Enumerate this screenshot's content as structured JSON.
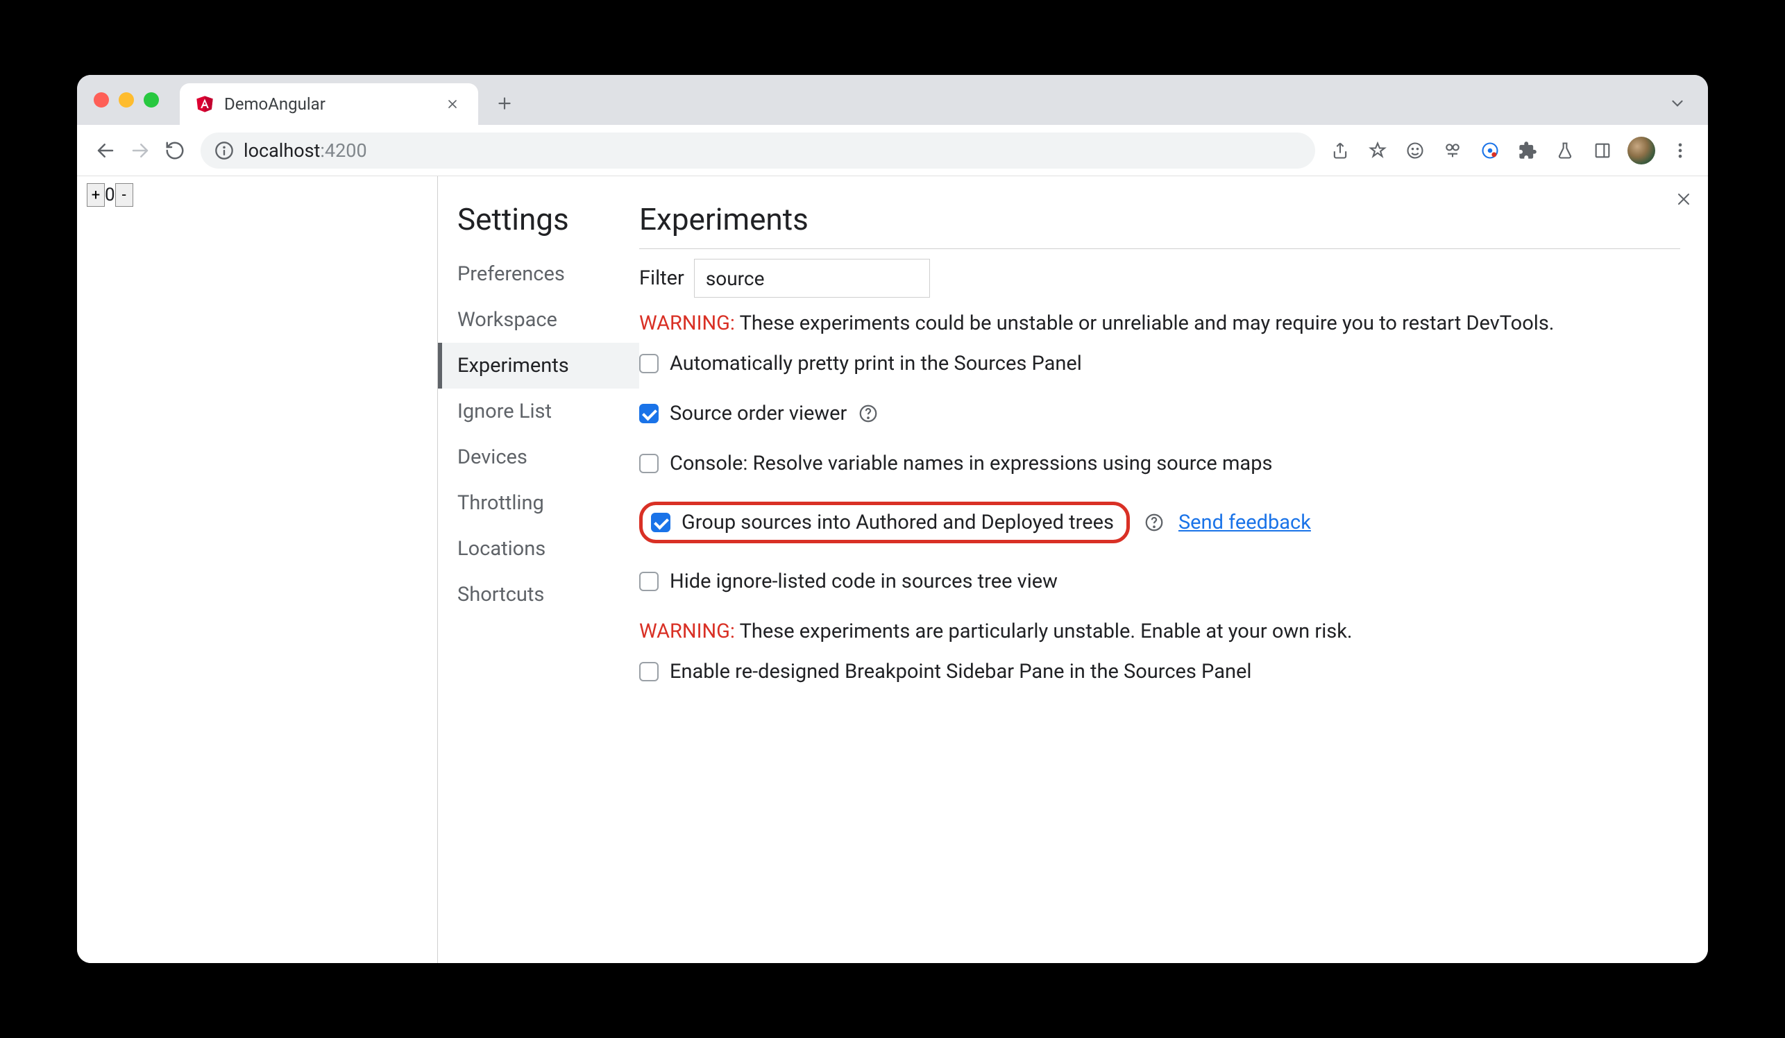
{
  "tab": {
    "title": "DemoAngular"
  },
  "omnibox": {
    "host": "localhost",
    "port": ":4200"
  },
  "pageControls": {
    "plus": "+",
    "value": "0",
    "minus": "-"
  },
  "settings": {
    "title": "Settings",
    "nav": [
      "Preferences",
      "Workspace",
      "Experiments",
      "Ignore List",
      "Devices",
      "Throttling",
      "Locations",
      "Shortcuts"
    ],
    "activeIndex": 2
  },
  "experiments": {
    "title": "Experiments",
    "filterLabel": "Filter",
    "filterValue": "source",
    "warning1Prefix": "WARNING:",
    "warning1Text": " These experiments could be unstable or unreliable and may require you to restart DevTools.",
    "rows": [
      {
        "label": "Automatically pretty print in the Sources Panel",
        "checked": false,
        "help": false
      },
      {
        "label": "Source order viewer",
        "checked": true,
        "help": true
      },
      {
        "label": "Console: Resolve variable names in expressions using source maps",
        "checked": false,
        "help": false
      },
      {
        "label": "Group sources into Authored and Deployed trees",
        "checked": true,
        "help": true,
        "highlight": true,
        "feedback": "Send feedback"
      },
      {
        "label": "Hide ignore-listed code in sources tree view",
        "checked": false,
        "help": false
      }
    ],
    "warning2Prefix": "WARNING:",
    "warning2Text": " These experiments are particularly unstable. Enable at your own risk.",
    "rows2": [
      {
        "label": "Enable re-designed Breakpoint Sidebar Pane in the Sources Panel",
        "checked": false
      }
    ]
  }
}
